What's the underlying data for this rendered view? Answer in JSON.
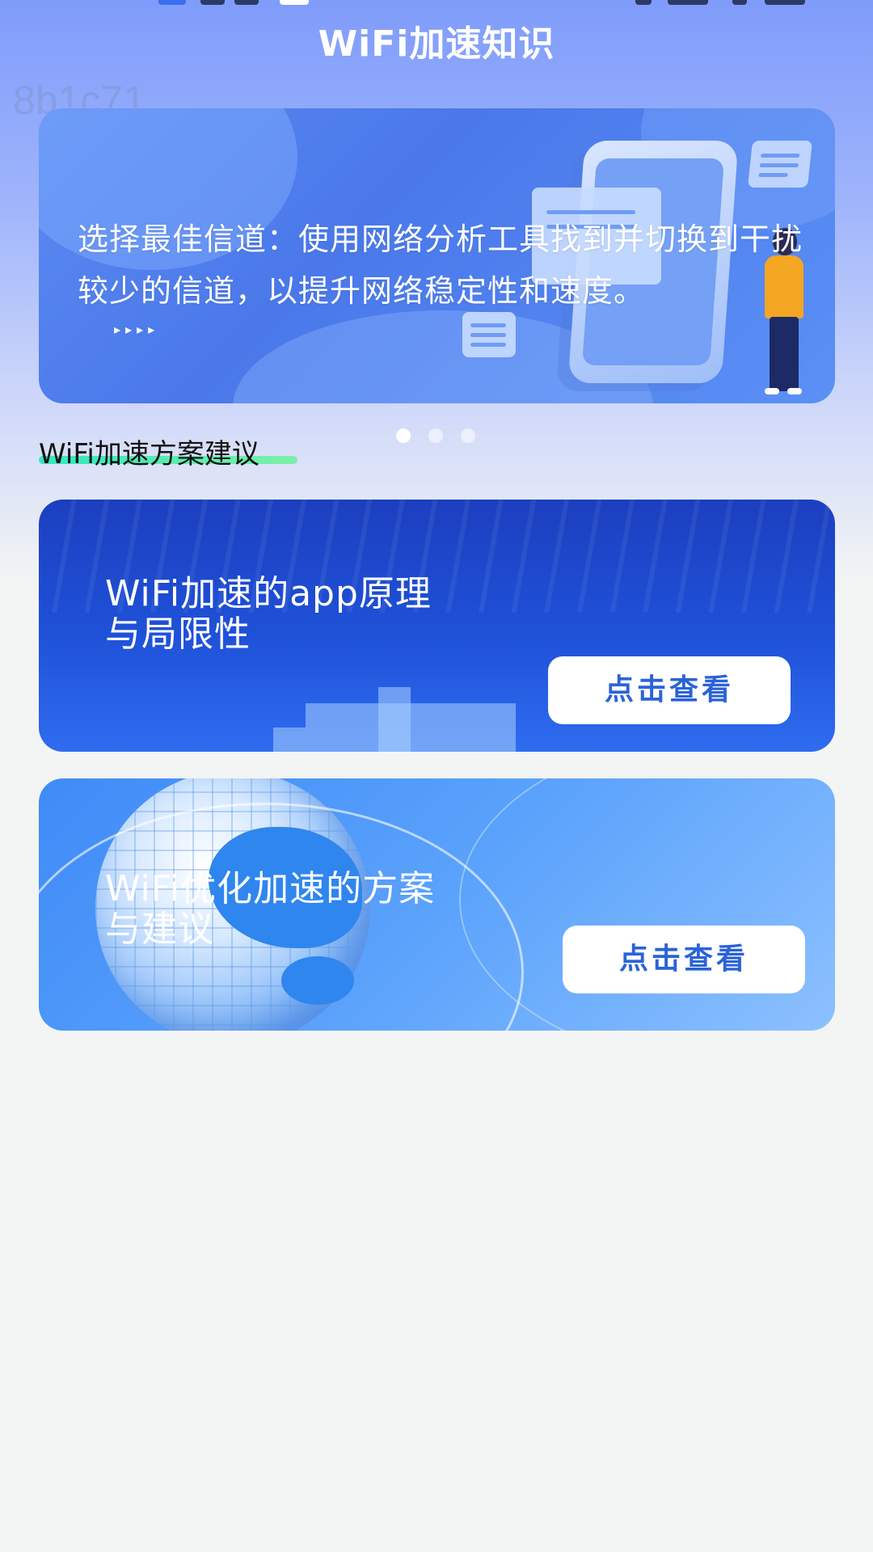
{
  "header": {
    "title": "WiFi加速知识",
    "watermark": "8b1c71"
  },
  "banner": {
    "text": "选择最佳信道：使用网络分析工具找到并切换到干扰较少的信道，以提升网络稳定性和速度。",
    "arrows": "▸▸▸▸",
    "dots": {
      "count": 3,
      "active_index": 0
    }
  },
  "section": {
    "title": "WiFi加速方案建议"
  },
  "cards": [
    {
      "title": "WiFi加速的app原理\n与局限性",
      "title_line1": "WiFi加速的app原理",
      "title_line2": "与局限性",
      "button_label": "点击查看"
    },
    {
      "title": "WiFi优化加速的方案\n与建议",
      "title_line1": "WiFi优化加速的方案",
      "title_line2": "与建议",
      "button_label": "点击查看"
    }
  ],
  "colors": {
    "accent": "#2a63d8",
    "header_gradient_top": "#7f9cfb",
    "underline": "#33e7c0"
  }
}
